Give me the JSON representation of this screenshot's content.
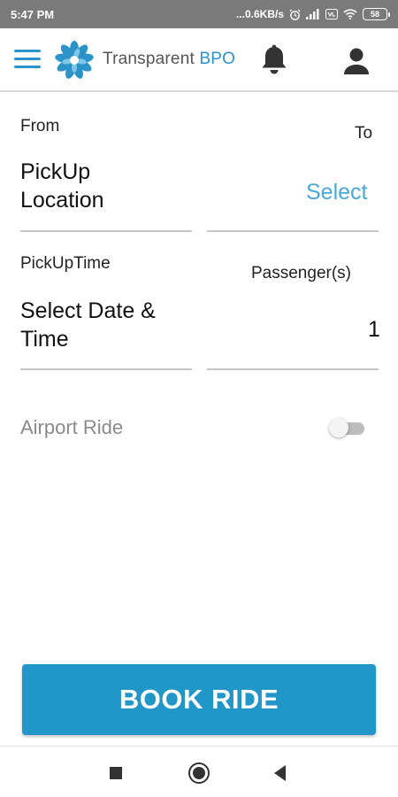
{
  "status_bar": {
    "time": "5:47 PM",
    "network_speed": "...0.6KB/s",
    "battery_level": "58",
    "icons": [
      "alarm-icon",
      "signal-icon",
      "volte-icon",
      "wifi-icon",
      "battery-icon"
    ]
  },
  "app_bar": {
    "brand_main": "Transparent ",
    "brand_accent": "BPO",
    "accent_color": "#2b93c8",
    "icons": [
      "menu-icon",
      "logo-icon",
      "bell-icon",
      "user-icon"
    ]
  },
  "form": {
    "from_label": "From",
    "to_label": "To",
    "pickup_location_line1": "PickUp",
    "pickup_location_line2": "Location",
    "destination_value": "Select",
    "pickup_time_label": "PickUpTime",
    "passengers_label": "Passenger(s)",
    "datetime_line1": "Select Date &",
    "datetime_line2": "Time",
    "passengers_value": "1",
    "airport_ride_label": "Airport Ride",
    "airport_ride_on": false
  },
  "actions": {
    "book_ride_label": "BOOK RIDE",
    "button_color": "#2196c8"
  },
  "nav_bar": {
    "icons": [
      "recents-icon",
      "home-icon",
      "back-icon"
    ]
  }
}
